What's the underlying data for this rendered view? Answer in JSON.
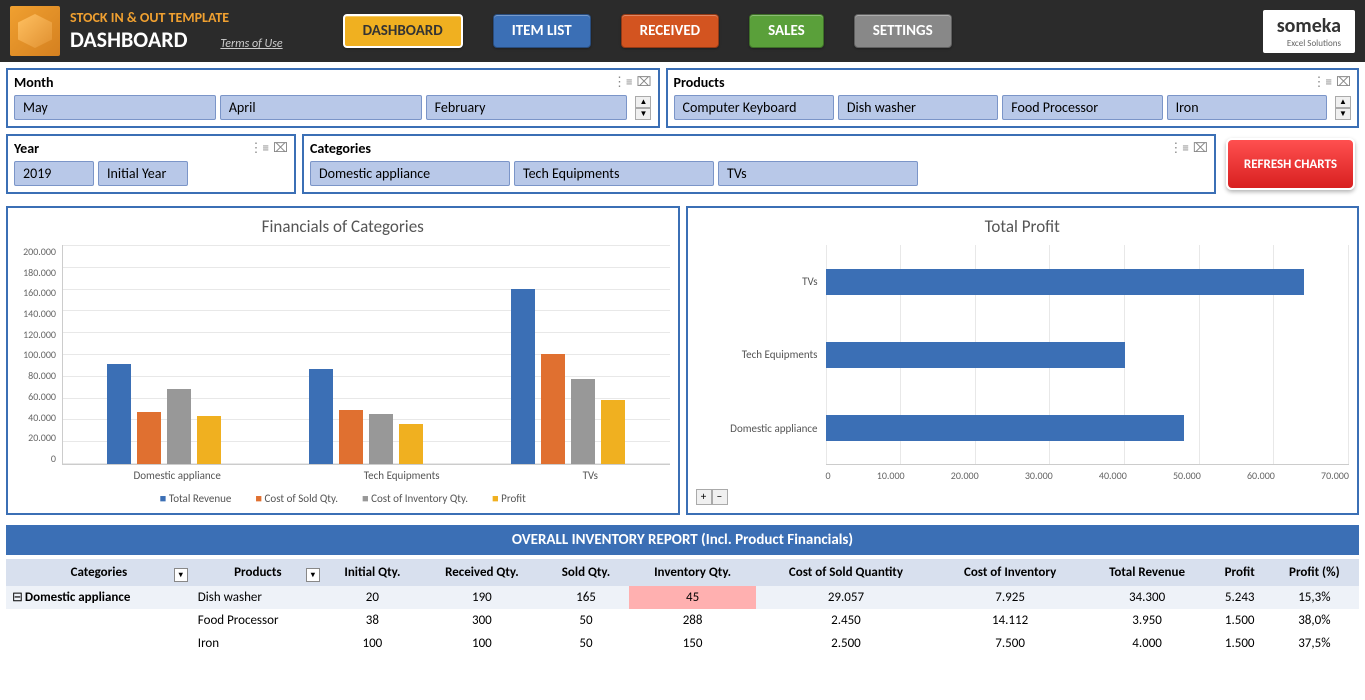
{
  "header": {
    "app_title": "STOCK IN & OUT TEMPLATE",
    "page_title": "DASHBOARD",
    "terms": "Terms of Use",
    "nav": {
      "dashboard": "DASHBOARD",
      "itemlist": "ITEM LIST",
      "received": "RECEIVED",
      "sales": "SALES",
      "settings": "SETTINGS"
    },
    "brand": "someka",
    "brand_sub": "Excel Solutions"
  },
  "slicers": {
    "month": {
      "title": "Month",
      "items": [
        "May",
        "April",
        "February"
      ]
    },
    "products": {
      "title": "Products",
      "items": [
        "Computer Keyboard",
        "Dish washer",
        "Food Processor",
        "Iron"
      ]
    },
    "year": {
      "title": "Year",
      "items": [
        "2019",
        "Initial Year"
      ]
    },
    "categories": {
      "title": "Categories",
      "items": [
        "Domestic appliance",
        "Tech Equipments",
        "TVs"
      ]
    }
  },
  "refresh": "REFRESH CHARTS",
  "chart_data": [
    {
      "type": "bar",
      "title": "Financials of Categories",
      "categories": [
        "Domestic appliance",
        "Tech Equipments",
        "TVs"
      ],
      "series": [
        {
          "name": "Total Revenue",
          "values": [
            100000,
            95000,
            175000
          ]
        },
        {
          "name": "Cost of Sold Qty.",
          "values": [
            52000,
            54000,
            110000
          ]
        },
        {
          "name": "Cost of Inventory Qty.",
          "values": [
            75000,
            50000,
            85000
          ]
        },
        {
          "name": "Profit",
          "values": [
            48000,
            40000,
            64000
          ]
        }
      ],
      "ylim": [
        0,
        200000
      ],
      "yticks": [
        "200.000",
        "180.000",
        "160.000",
        "140.000",
        "120.000",
        "100.000",
        "80.000",
        "60.000",
        "40.000",
        "20.000",
        "0"
      ]
    },
    {
      "type": "bar",
      "orientation": "horizontal",
      "title": "Total Profit",
      "categories": [
        "TVs",
        "Tech Equipments",
        "Domestic appliance"
      ],
      "values": [
        64000,
        40000,
        48000
      ],
      "xlim": [
        0,
        70000
      ],
      "xticks": [
        "0",
        "10.000",
        "20.000",
        "30.000",
        "40.000",
        "50.000",
        "60.000",
        "70.000"
      ]
    }
  ],
  "report": {
    "title": "OVERALL INVENTORY REPORT (Incl. Product Financials)",
    "columns": [
      "Categories",
      "Products",
      "Initial Qty.",
      "Received Qty.",
      "Sold Qty.",
      "Inventory Qty.",
      "Cost of Sold Quantity",
      "Cost of Inventory",
      "Total Revenue",
      "Profit",
      "Profit (%)"
    ],
    "rows": [
      {
        "cat": "Domestic appliance",
        "prod": "Dish washer",
        "init": "20",
        "recv": "190",
        "sold": "165",
        "inv": "45",
        "csq": "29.057",
        "ci": "7.925",
        "tr": "34.300",
        "pr": "5.243",
        "pp": "15,3%",
        "hl": true
      },
      {
        "cat": "",
        "prod": "Food Processor",
        "init": "38",
        "recv": "300",
        "sold": "50",
        "inv": "288",
        "csq": "2.450",
        "ci": "14.112",
        "tr": "3.950",
        "pr": "1.500",
        "pp": "38,0%"
      },
      {
        "cat": "",
        "prod": "Iron",
        "init": "100",
        "recv": "100",
        "sold": "50",
        "inv": "150",
        "csq": "2.500",
        "ci": "7.500",
        "tr": "4.000",
        "pr": "1.500",
        "pp": "37,5%"
      }
    ]
  }
}
